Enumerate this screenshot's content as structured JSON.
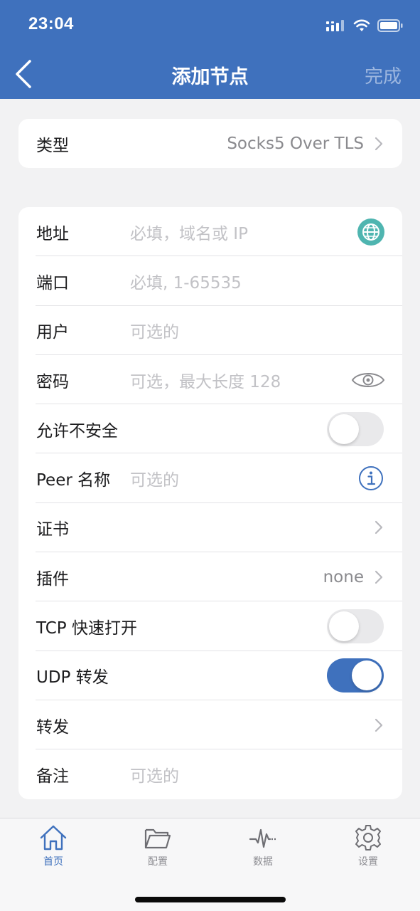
{
  "status_bar": {
    "time": "23:04"
  },
  "nav": {
    "title": "添加节点",
    "done_label": "完成"
  },
  "type_row": {
    "label": "类型",
    "value": "Socks5 Over TLS"
  },
  "form": {
    "address": {
      "label": "地址",
      "placeholder": "必填，域名或 IP"
    },
    "port": {
      "label": "端口",
      "placeholder": "必填, 1-65535"
    },
    "user": {
      "label": "用户",
      "placeholder": "可选的"
    },
    "password": {
      "label": "密码",
      "placeholder": "可选，最大长度 128"
    },
    "allow_insecure": {
      "label": "允许不安全",
      "on": false
    },
    "peer_name": {
      "label": "Peer 名称",
      "placeholder": "可选的"
    },
    "certificate": {
      "label": "证书"
    },
    "plugin": {
      "label": "插件",
      "value": "none"
    },
    "tcp_fast_open": {
      "label": "TCP 快速打开",
      "on": false
    },
    "udp_forward": {
      "label": "UDP 转发",
      "on": true
    },
    "forward": {
      "label": "转发"
    },
    "remark": {
      "label": "备注",
      "placeholder": "可选的"
    }
  },
  "tabs": [
    {
      "label": "首页",
      "icon": "home-icon",
      "active": true
    },
    {
      "label": "配置",
      "icon": "folder-icon",
      "active": false
    },
    {
      "label": "数据",
      "icon": "pulse-icon",
      "active": false
    },
    {
      "label": "设置",
      "icon": "gear-icon",
      "active": false
    }
  ],
  "colors": {
    "accent": "#3f71bd",
    "globe": "#4fb5b0",
    "background": "#f2f2f3"
  }
}
